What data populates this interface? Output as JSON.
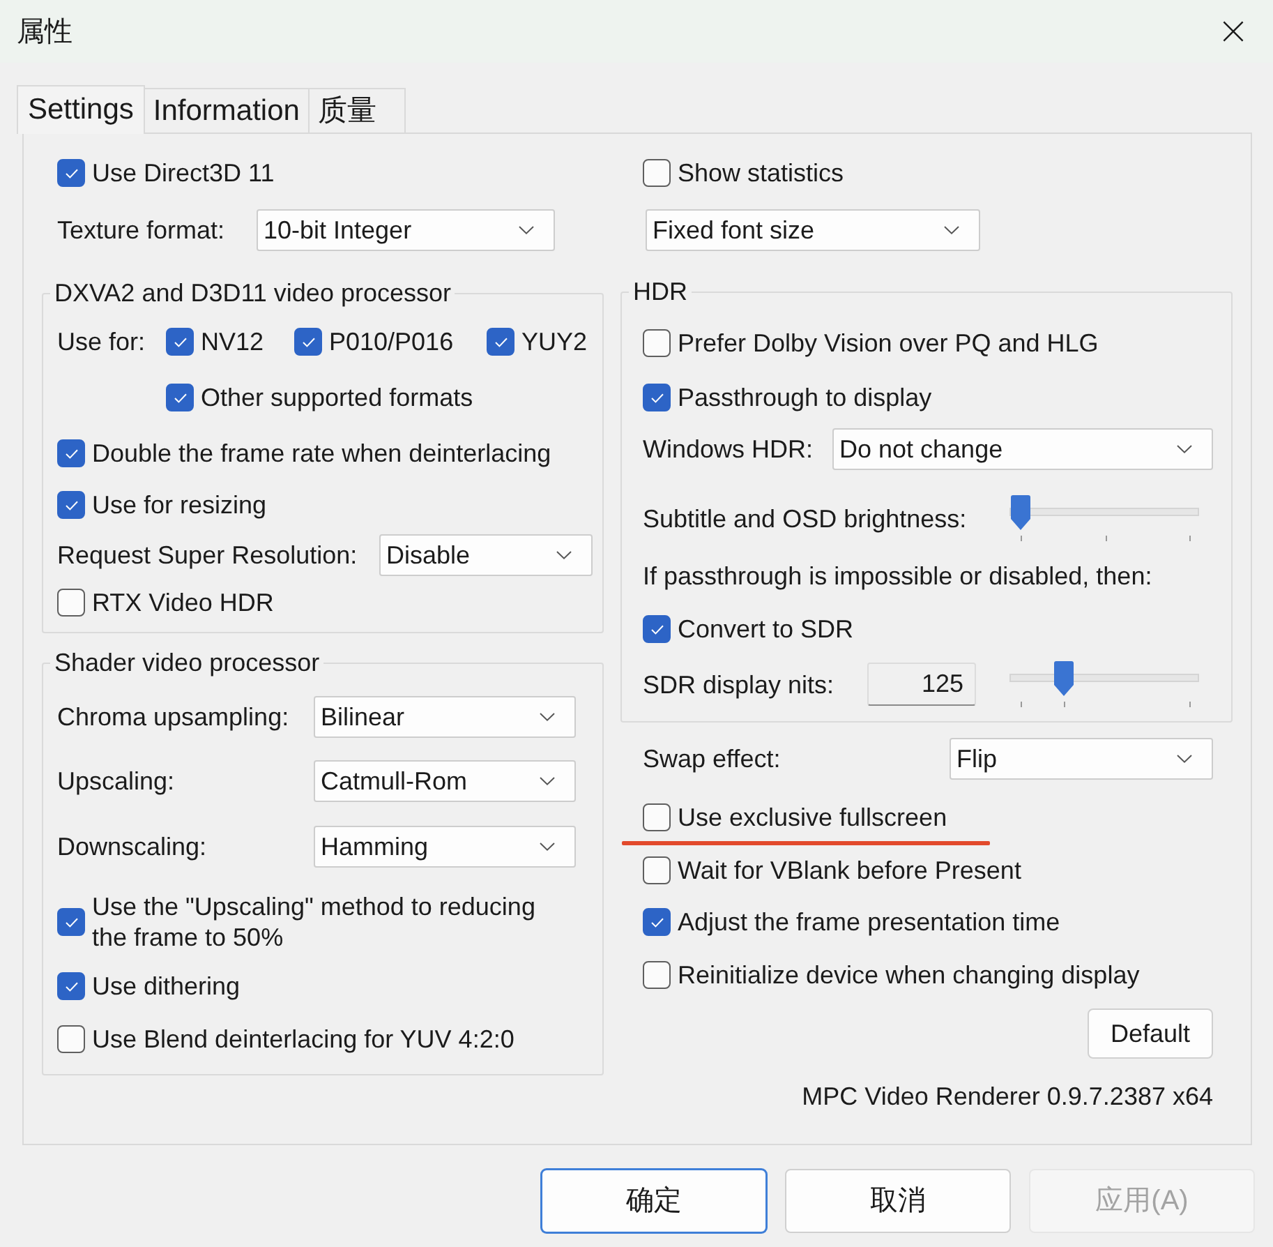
{
  "window": {
    "title": "属性"
  },
  "tabs": [
    {
      "label": "Settings",
      "selected": true
    },
    {
      "label": "Information",
      "selected": false
    },
    {
      "label": "质量",
      "selected": false
    }
  ],
  "left_column": {
    "direct3d11": {
      "label": "Use Direct3D 11",
      "checked": true
    },
    "texture_format": {
      "label": "Texture format:",
      "value": "10-bit Integer"
    },
    "dxva_group": {
      "title": "DXVA2 and D3D11 video processor",
      "use_for": {
        "label": "Use for:",
        "formats": [
          {
            "label": "NV12",
            "checked": true
          },
          {
            "label": "P010/P016",
            "checked": true
          },
          {
            "label": "YUY2",
            "checked": true
          },
          {
            "label": "Other supported formats",
            "checked": true
          }
        ]
      },
      "options": [
        {
          "label": "Double the frame rate when deinterlacing",
          "checked": true
        },
        {
          "label": "Use for resizing",
          "checked": true
        }
      ],
      "super_resolution": {
        "label": "Request Super Resolution:",
        "value": "Disable"
      },
      "rtx_video_hdr": {
        "label": "RTX Video HDR",
        "checked": false
      }
    },
    "shader_group": {
      "title": "Shader video processor",
      "selects": [
        {
          "label": "Chroma upsampling:",
          "value": "Bilinear"
        },
        {
          "label": "Upscaling:",
          "value": "Catmull-Rom"
        },
        {
          "label": "Downscaling:",
          "value": "Hamming"
        }
      ],
      "options": [
        {
          "label": "Use the \"Upscaling\" method to reducing the frame to 50%",
          "checked": true
        },
        {
          "label": "Use dithering",
          "checked": true
        },
        {
          "label": "Use Blend deinterlacing for YUV 4:2:0",
          "checked": false
        }
      ]
    }
  },
  "right_column": {
    "show_statistics": {
      "label": "Show statistics",
      "checked": false
    },
    "statistics_font": {
      "value": "Fixed font size"
    },
    "hdr_group": {
      "title": "HDR",
      "options": [
        {
          "label": "Prefer Dolby Vision over PQ and HLG",
          "checked": false
        },
        {
          "label": "Passthrough to display",
          "checked": true
        }
      ],
      "windows_hdr": {
        "label": "Windows HDR:",
        "value": "Do not change"
      },
      "osd_brightness": {
        "label": "Subtitle and OSD brightness:",
        "level": 0
      },
      "fallback_text": "If passthrough is impossible or disabled, then:",
      "convert_to_sdr": {
        "label": "Convert to SDR",
        "checked": true
      },
      "sdr_nits": {
        "label": "SDR display nits:",
        "value": "125",
        "level": 0.26
      }
    },
    "swap_effect": {
      "label": "Swap effect:",
      "value": "Flip"
    },
    "options": [
      {
        "label": "Use exclusive fullscreen",
        "checked": false,
        "underlined": true
      },
      {
        "label": "Wait for VBlank before Present",
        "checked": false,
        "underlined": false
      },
      {
        "label": "Adjust the frame presentation time",
        "checked": true,
        "underlined": false
      },
      {
        "label": "Reinitialize device when changing display",
        "checked": false,
        "underlined": false
      }
    ],
    "default_button": "Default",
    "version": "MPC Video Renderer 0.9.7.2387 x64"
  },
  "buttons": [
    {
      "label": "确定",
      "focused": true,
      "disabled": false
    },
    {
      "label": "取消",
      "focused": false,
      "disabled": false
    },
    {
      "label": "应用(A)",
      "focused": false,
      "disabled": true
    }
  ]
}
